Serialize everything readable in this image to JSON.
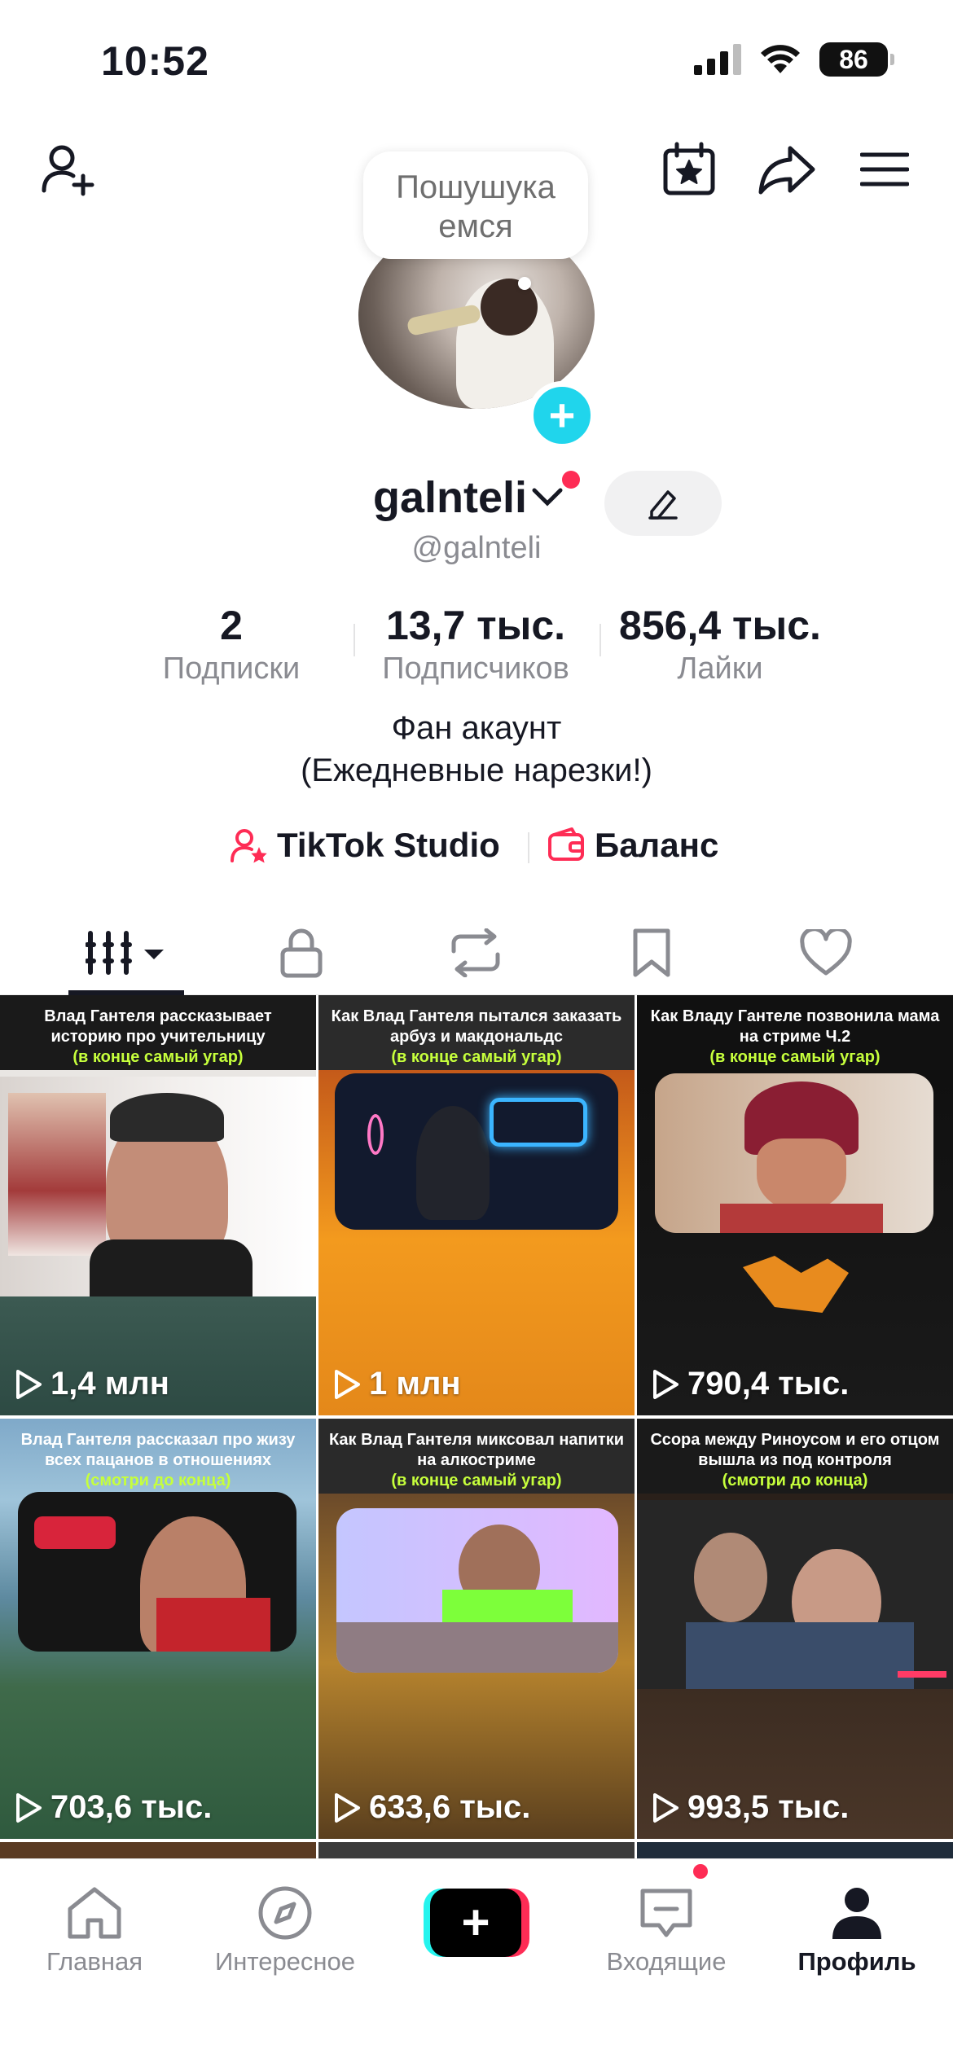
{
  "status_bar": {
    "time": "10:52",
    "battery": "86"
  },
  "profile": {
    "bubble_text": "Пошушука емся",
    "username": "galnteli",
    "handle": "@galnteli",
    "stats": [
      {
        "value": "2",
        "label": "Подписки"
      },
      {
        "value": "13,7 тыс.",
        "label": "Подписчиков"
      },
      {
        "value": "856,4 тыс.",
        "label": "Лайки"
      }
    ],
    "bio_line1": "Фан акаунт",
    "bio_line2": "(Ежедневные нарезки!)",
    "links": {
      "studio": "TikTok Studio",
      "balance": "Баланс"
    }
  },
  "tabs": [
    "videos-icon",
    "lock-icon",
    "repost-icon",
    "bookmark-icon",
    "heart-icon"
  ],
  "videos": [
    {
      "title": "Влад Гантеля рассказывает историю про учительницу",
      "note": "(в конце самый угар)",
      "views": "1,4 млн"
    },
    {
      "title": "Как Влад Гантеля пытался заказать арбуз и макдональдс",
      "note": "(в конце самый угар)",
      "views": "1 млн"
    },
    {
      "title": "Как Владу Гантеле позвонила мама на стриме Ч.2",
      "note": "(в конце самый угар)",
      "views": "790,4 тыс."
    },
    {
      "title": "Влад Гантеля рассказал про жизу всех пацанов в отношениях",
      "note": "(смотри до конца)",
      "views": "703,6 тыс."
    },
    {
      "title": "Как Влад Гантеля миксовал напитки на алкостриме",
      "note": "(в конце самый угар)",
      "views": "633,6 тыс."
    },
    {
      "title": "Ссора между Риноусом и его отцом вышла из под контроля",
      "note": "(смотри до конца)",
      "views": "993,5 тыс."
    }
  ],
  "bottom_nav": {
    "home": "Главная",
    "explore": "Интересное",
    "create": "+",
    "inbox": "Входящие",
    "profile": "Профиль"
  }
}
